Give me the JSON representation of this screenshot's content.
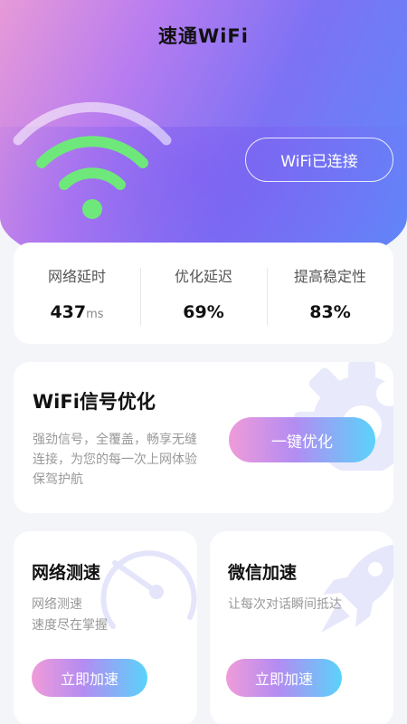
{
  "app": {
    "title": "速通WiFi"
  },
  "hero": {
    "status_label": "WiFi已连接"
  },
  "stats": [
    {
      "label": "网络延时",
      "value": "437",
      "unit": "ms"
    },
    {
      "label": "优化延迟",
      "value": "69%",
      "unit": ""
    },
    {
      "label": "提高稳定性",
      "value": "83%",
      "unit": ""
    }
  ],
  "optimize": {
    "title": "WiFi信号优化",
    "description": "强劲信号，全覆盖，畅享无缝连接，为您的每一次上网体验保驾护航",
    "button_label": "一键优化"
  },
  "speed_test": {
    "title": "网络测速",
    "description_line1": "网络测速",
    "description_line2": "速度尽在掌握",
    "button_label": "立即加速"
  },
  "wechat_boost": {
    "title": "微信加速",
    "description": "让每次对话瞬间抵达",
    "button_label": "立即加速"
  },
  "colors": {
    "accent_gradient_start": "#f09bd9",
    "accent_gradient_end": "#5ad3fa",
    "wifi_green": "#6ee87a",
    "hero_start": "#e79ad8",
    "hero_end": "#5c8bfa"
  },
  "icons": {
    "hero": "wifi-icon",
    "optimize_deco": "gear-icon",
    "speed_deco": "speedometer-icon",
    "wechat_deco": "rocket-icon"
  }
}
